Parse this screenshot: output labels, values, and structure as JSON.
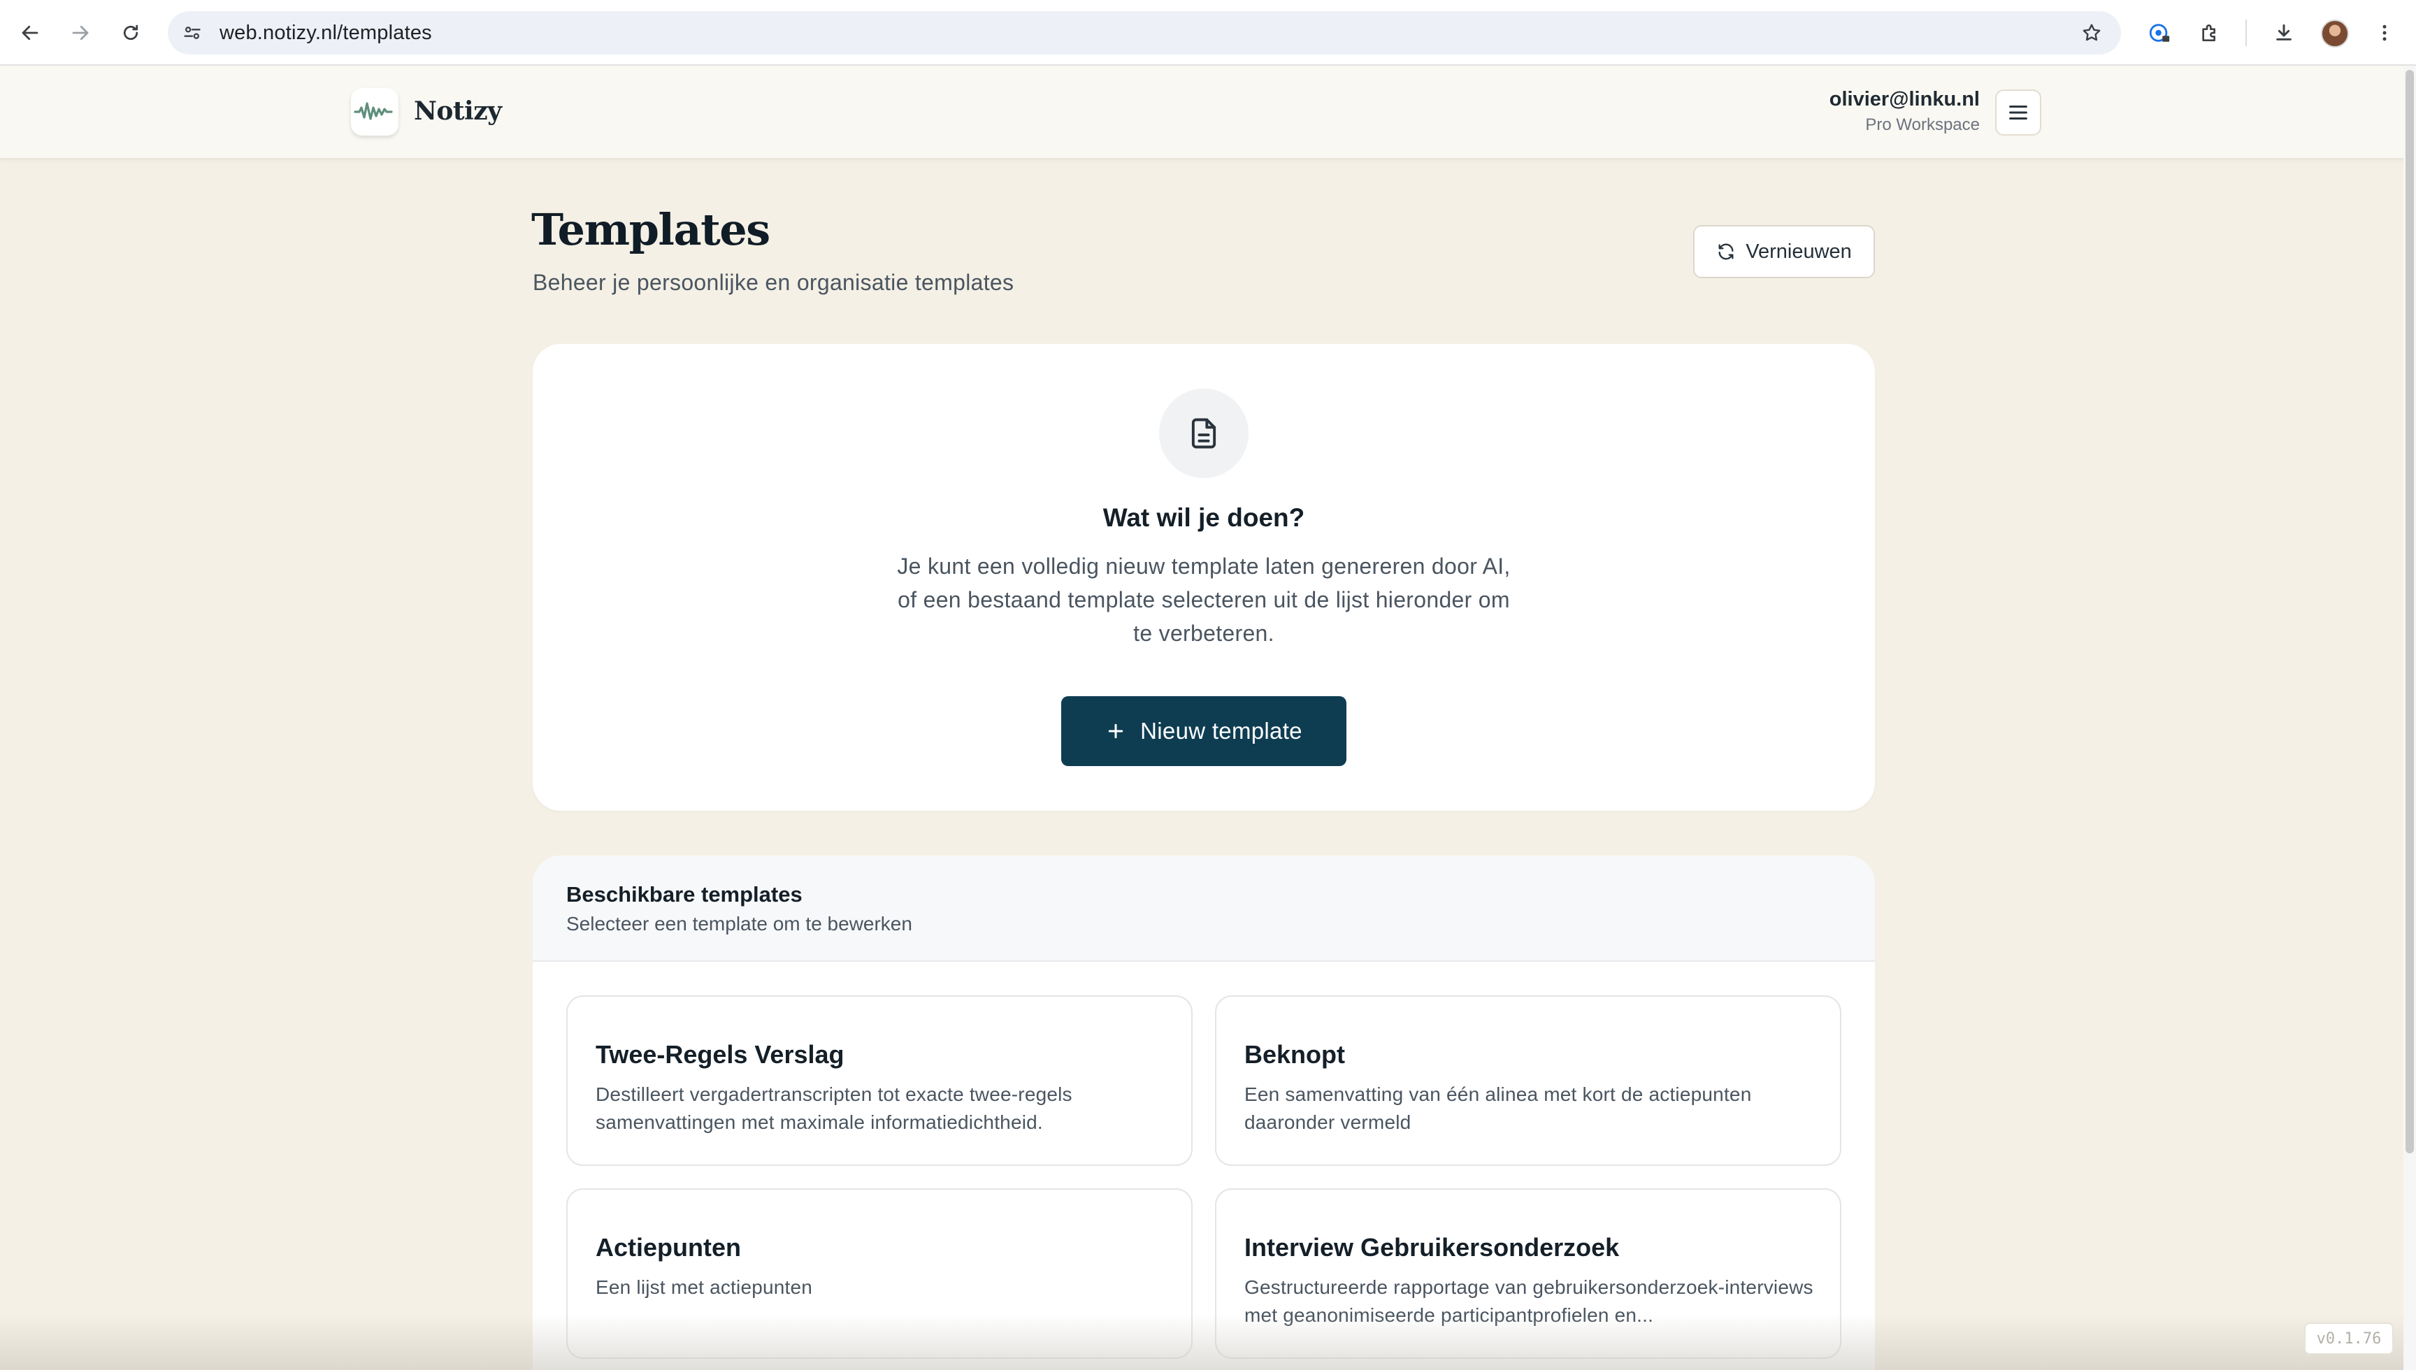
{
  "browser": {
    "url": "web.notizy.nl/templates",
    "icons": [
      "back-icon",
      "forward-icon",
      "reload-icon",
      "site-info-icon",
      "bookmark-star-icon",
      "password-manager-icon",
      "extensions-icon",
      "downloads-icon",
      "profile-avatar",
      "more-menu-icon"
    ]
  },
  "header": {
    "app_name": "Notizy",
    "account_email": "olivier@linku.nl",
    "account_plan": "Pro Workspace"
  },
  "page": {
    "title": "Templates",
    "subtitle": "Beheer je persoonlijke en organisatie templates",
    "refresh_label": "Vernieuwen"
  },
  "action_card": {
    "title": "Wat wil je doen?",
    "description": "Je kunt een volledig nieuw template laten genereren door AI, of een bestaand template selecteren uit de lijst hieronder om te verbeteren.",
    "new_button_label": "Nieuw template"
  },
  "templates": {
    "title": "Beschikbare templates",
    "subtitle": "Selecteer een template om te bewerken",
    "items": [
      {
        "name": "Twee-Regels Verslag",
        "description": "Destilleert vergadertranscripten tot exacte twee-regels samenvattingen met maximale informatiedichtheid."
      },
      {
        "name": "Beknopt",
        "description": "Een samenvatting van één alinea met kort de actiepunten daaronder vermeld"
      },
      {
        "name": "Actiepunten",
        "description": "Een lijst met actiepunten"
      },
      {
        "name": "Interview Gebruikersonderzoek",
        "description": "Gestructureerde rapportage van gebruikersonderzoek-interviews met geanonimiseerde participantprofielen en..."
      }
    ]
  },
  "version": "v0.1.76",
  "colors": {
    "page_bg": "#f4f0e5",
    "primary": "#0e3d52",
    "logo_green": "#5f8f7c"
  }
}
